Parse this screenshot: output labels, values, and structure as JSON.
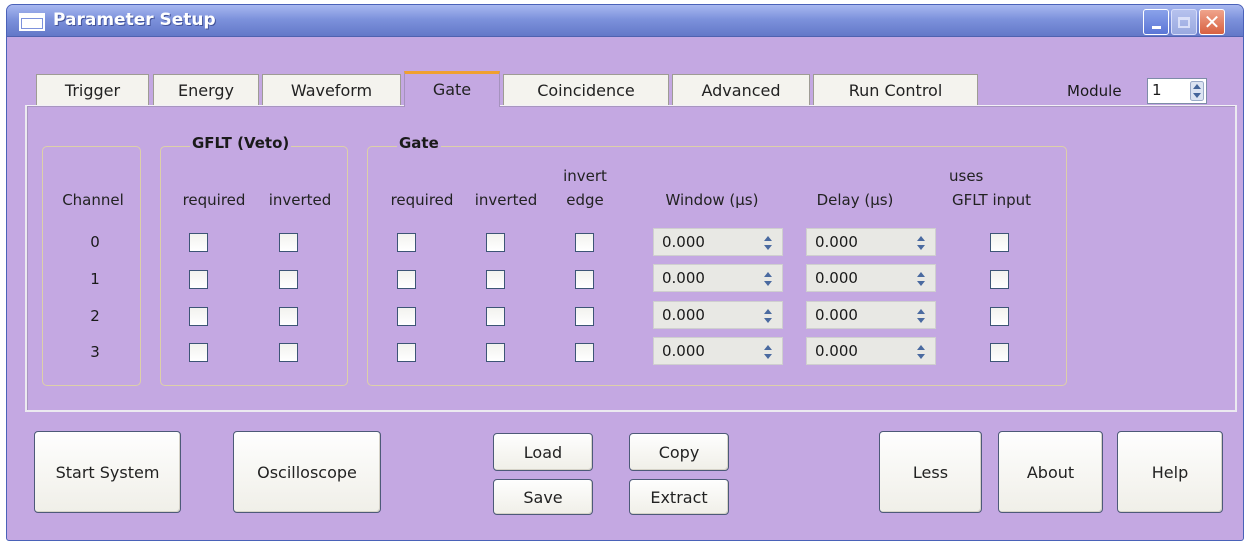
{
  "window": {
    "title": "Parameter Setup"
  },
  "tabs": [
    "Trigger",
    "Energy",
    "Waveform",
    "Gate",
    "Coincidence",
    "Advanced",
    "Run Control"
  ],
  "active_tab": "Gate",
  "module": {
    "label": "Module",
    "value": "1"
  },
  "gflt_group": {
    "title": "GFLT (Veto)",
    "required": "required",
    "inverted": "inverted"
  },
  "gate_group": {
    "title": "Gate",
    "required": "required",
    "inverted": "inverted",
    "invert_edge": [
      "invert",
      "edge"
    ],
    "window": "Window (µs)",
    "delay": "Delay (µs)",
    "uses_gflt": [
      "uses",
      "GFLT input"
    ]
  },
  "channel_header": "Channel",
  "channels": [
    {
      "label": "0",
      "window": "0.000",
      "delay": "0.000"
    },
    {
      "label": "1",
      "window": "0.000",
      "delay": "0.000"
    },
    {
      "label": "2",
      "window": "0.000",
      "delay": "0.000"
    },
    {
      "label": "3",
      "window": "0.000",
      "delay": "0.000"
    }
  ],
  "buttons": {
    "start_system": "Start System",
    "oscilloscope": "Oscilloscope",
    "load": "Load",
    "save": "Save",
    "copy": "Copy",
    "extract": "Extract",
    "less": "Less",
    "about": "About",
    "help": "Help"
  },
  "colors": {
    "panel_bg": "#c4a8e2",
    "titlebar": "#7d92dc",
    "tab_accent": "#f0a030"
  }
}
